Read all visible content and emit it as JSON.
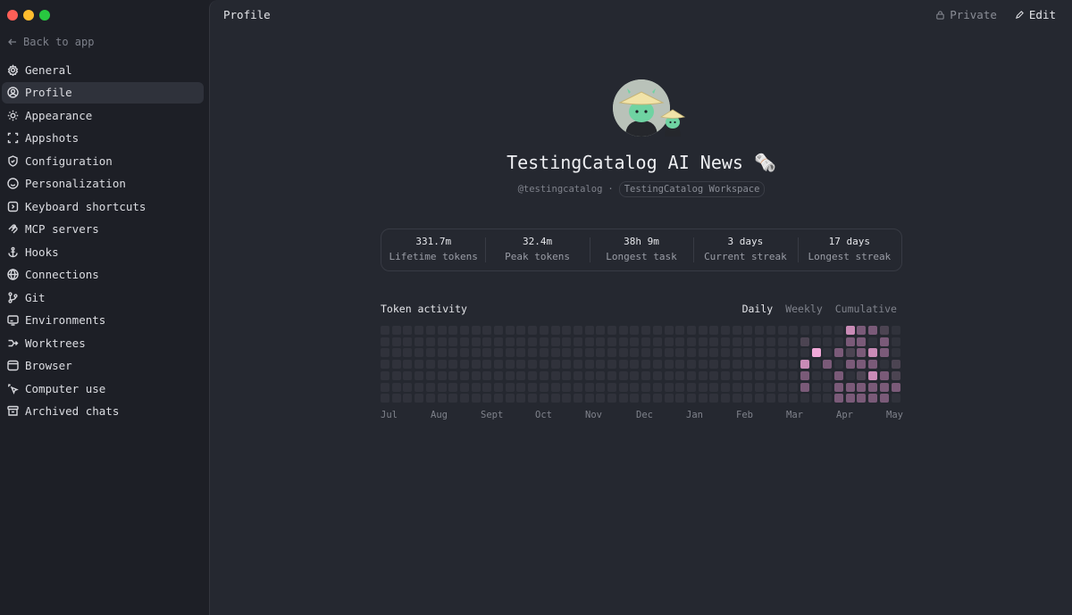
{
  "sidebar": {
    "back_label": "Back to app",
    "items": [
      {
        "label": "General",
        "icon": "gear-icon",
        "active": false
      },
      {
        "label": "Profile",
        "icon": "user-circle-icon",
        "active": true
      },
      {
        "label": "Appearance",
        "icon": "sun-icon",
        "active": false
      },
      {
        "label": "Appshots",
        "icon": "screenshot-icon",
        "active": false
      },
      {
        "label": "Configuration",
        "icon": "shield-icon",
        "active": false
      },
      {
        "label": "Personalization",
        "icon": "smile-icon",
        "active": false
      },
      {
        "label": "Keyboard shortcuts",
        "icon": "keyboard-icon",
        "active": false
      },
      {
        "label": "MCP servers",
        "icon": "mcp-icon",
        "active": false
      },
      {
        "label": "Hooks",
        "icon": "anchor-icon",
        "active": false
      },
      {
        "label": "Connections",
        "icon": "globe-icon",
        "active": false
      },
      {
        "label": "Git",
        "icon": "git-branch-icon",
        "active": false
      },
      {
        "label": "Environments",
        "icon": "monitor-icon",
        "active": false
      },
      {
        "label": "Worktrees",
        "icon": "worktree-icon",
        "active": false
      },
      {
        "label": "Browser",
        "icon": "browser-icon",
        "active": false
      },
      {
        "label": "Computer use",
        "icon": "pointer-click-icon",
        "active": false
      },
      {
        "label": "Archived chats",
        "icon": "archive-icon",
        "active": false
      }
    ]
  },
  "header": {
    "title": "Profile",
    "private_label": "Private",
    "edit_label": "Edit"
  },
  "profile": {
    "name": "TestingCatalog AI News 🗞️",
    "handle": "@testingcatalog",
    "separator": "·",
    "workspace": "TestingCatalog Workspace"
  },
  "stats": [
    {
      "value": "331.7m",
      "label": "Lifetime tokens"
    },
    {
      "value": "32.4m",
      "label": "Peak tokens"
    },
    {
      "value": "38h 9m",
      "label": "Longest task"
    },
    {
      "value": "3 days",
      "label": "Current streak"
    },
    {
      "value": "17 days",
      "label": "Longest streak"
    }
  ],
  "activity": {
    "title": "Token activity",
    "tabs": [
      {
        "label": "Daily",
        "active": true
      },
      {
        "label": "Weekly",
        "active": false
      },
      {
        "label": "Cumulative",
        "active": false
      }
    ],
    "months": [
      "Jul",
      "Aug",
      "Sept",
      "Oct",
      "Nov",
      "Dec",
      "Jan",
      "Feb",
      "Mar",
      "Apr",
      "May"
    ],
    "weeks": 46,
    "days_per_week": 7,
    "levels": {
      "37": [
        0,
        1,
        0,
        3,
        2,
        2,
        0
      ],
      "39": [
        0,
        0,
        0,
        2,
        0,
        0,
        0
      ],
      "40": [
        0,
        0,
        2,
        0,
        2,
        2,
        2
      ],
      "41": [
        3,
        2,
        1,
        2,
        0,
        2,
        2
      ],
      "42": [
        2,
        2,
        2,
        2,
        1,
        2,
        2
      ],
      "43": [
        2,
        0,
        3,
        2,
        3,
        2,
        2
      ],
      "44": [
        1,
        2,
        2,
        0,
        2,
        2,
        2
      ],
      "45": [
        0,
        0,
        0,
        1,
        1,
        2,
        0
      ]
    },
    "colors": {
      "0": "#30323b",
      "1": "#4c4452",
      "2": "#7a5a78",
      "3": "#c98bb6",
      "4": "#f0a8d8"
    },
    "highlight": {
      "week": 38,
      "day": 2,
      "level": 4
    }
  }
}
